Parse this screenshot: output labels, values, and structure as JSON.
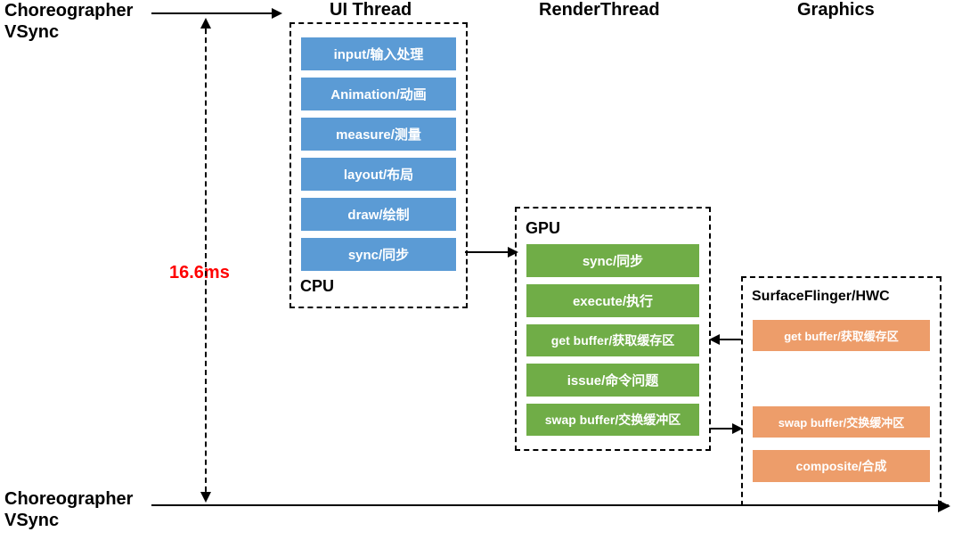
{
  "headers": {
    "choreographer": "Choreographer",
    "vsync": "VSync",
    "ui_thread": "UI Thread",
    "render_thread": "RenderThread",
    "graphics": "Graphics"
  },
  "timing": "16.6ms",
  "cpu": {
    "label": "CPU",
    "stages": [
      "input/输入处理",
      "Animation/动画",
      "measure/测量",
      "layout/布局",
      "draw/绘制",
      "sync/同步"
    ]
  },
  "gpu": {
    "label": "GPU",
    "stages": [
      "sync/同步",
      "execute/执行",
      "get buffer/获取缓存区",
      "issue/命令问题",
      "swap buffer/交换缓冲区"
    ]
  },
  "sf": {
    "label": "SurfaceFlinger/HWC",
    "stages": [
      "get buffer/获取缓存区",
      "swap buffer/交换缓冲区",
      "composite/合成"
    ]
  }
}
